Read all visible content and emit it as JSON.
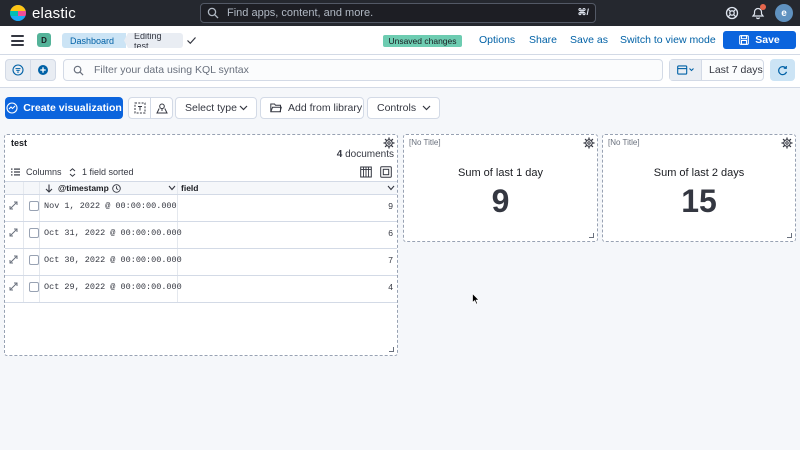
{
  "header": {
    "brand": "elastic",
    "search_placeholder": "Find apps, content, and more.",
    "search_shortcut": "⌘/",
    "user_initial": "e"
  },
  "breadcrumbs": {
    "space_initial": "D",
    "items": [
      "Dashboard",
      "Editing test"
    ]
  },
  "top_menu": {
    "badge": "Unsaved changes",
    "links": [
      "Options",
      "Share",
      "Save as",
      "Switch to view mode"
    ],
    "save_label": "Save"
  },
  "query_bar": {
    "placeholder": "Filter your data using KQL syntax",
    "date_range": "Last 7 days"
  },
  "toolbar": {
    "create_label": "Create visualization",
    "select_type": "Select type",
    "add_from_library": "Add from library",
    "controls": "Controls"
  },
  "panel_table": {
    "title": "test",
    "doc_count": "4",
    "doc_count_label": "documents",
    "columns_label": "Columns",
    "sorted_label": "1 field sorted",
    "headers": [
      "@timestamp",
      "field"
    ],
    "rows": [
      {
        "timestamp": "Nov 1, 2022 @ 00:00:00.000",
        "field": "9"
      },
      {
        "timestamp": "Oct 31, 2022 @ 00:00:00.000",
        "field": "6"
      },
      {
        "timestamp": "Oct 30, 2022 @ 00:00:00.000",
        "field": "7"
      },
      {
        "timestamp": "Oct 29, 2022 @ 00:00:00.000",
        "field": "4"
      }
    ]
  },
  "metrics": [
    {
      "title": "[No Title]",
      "label": "Sum of last 1 day",
      "value": "9"
    },
    {
      "title": "[No Title]",
      "label": "Sum of last 2 days",
      "value": "15"
    }
  ],
  "colors": {
    "primary": "#0b64dd",
    "header_bg": "#25282f",
    "success_badge": "#6dccb1"
  }
}
